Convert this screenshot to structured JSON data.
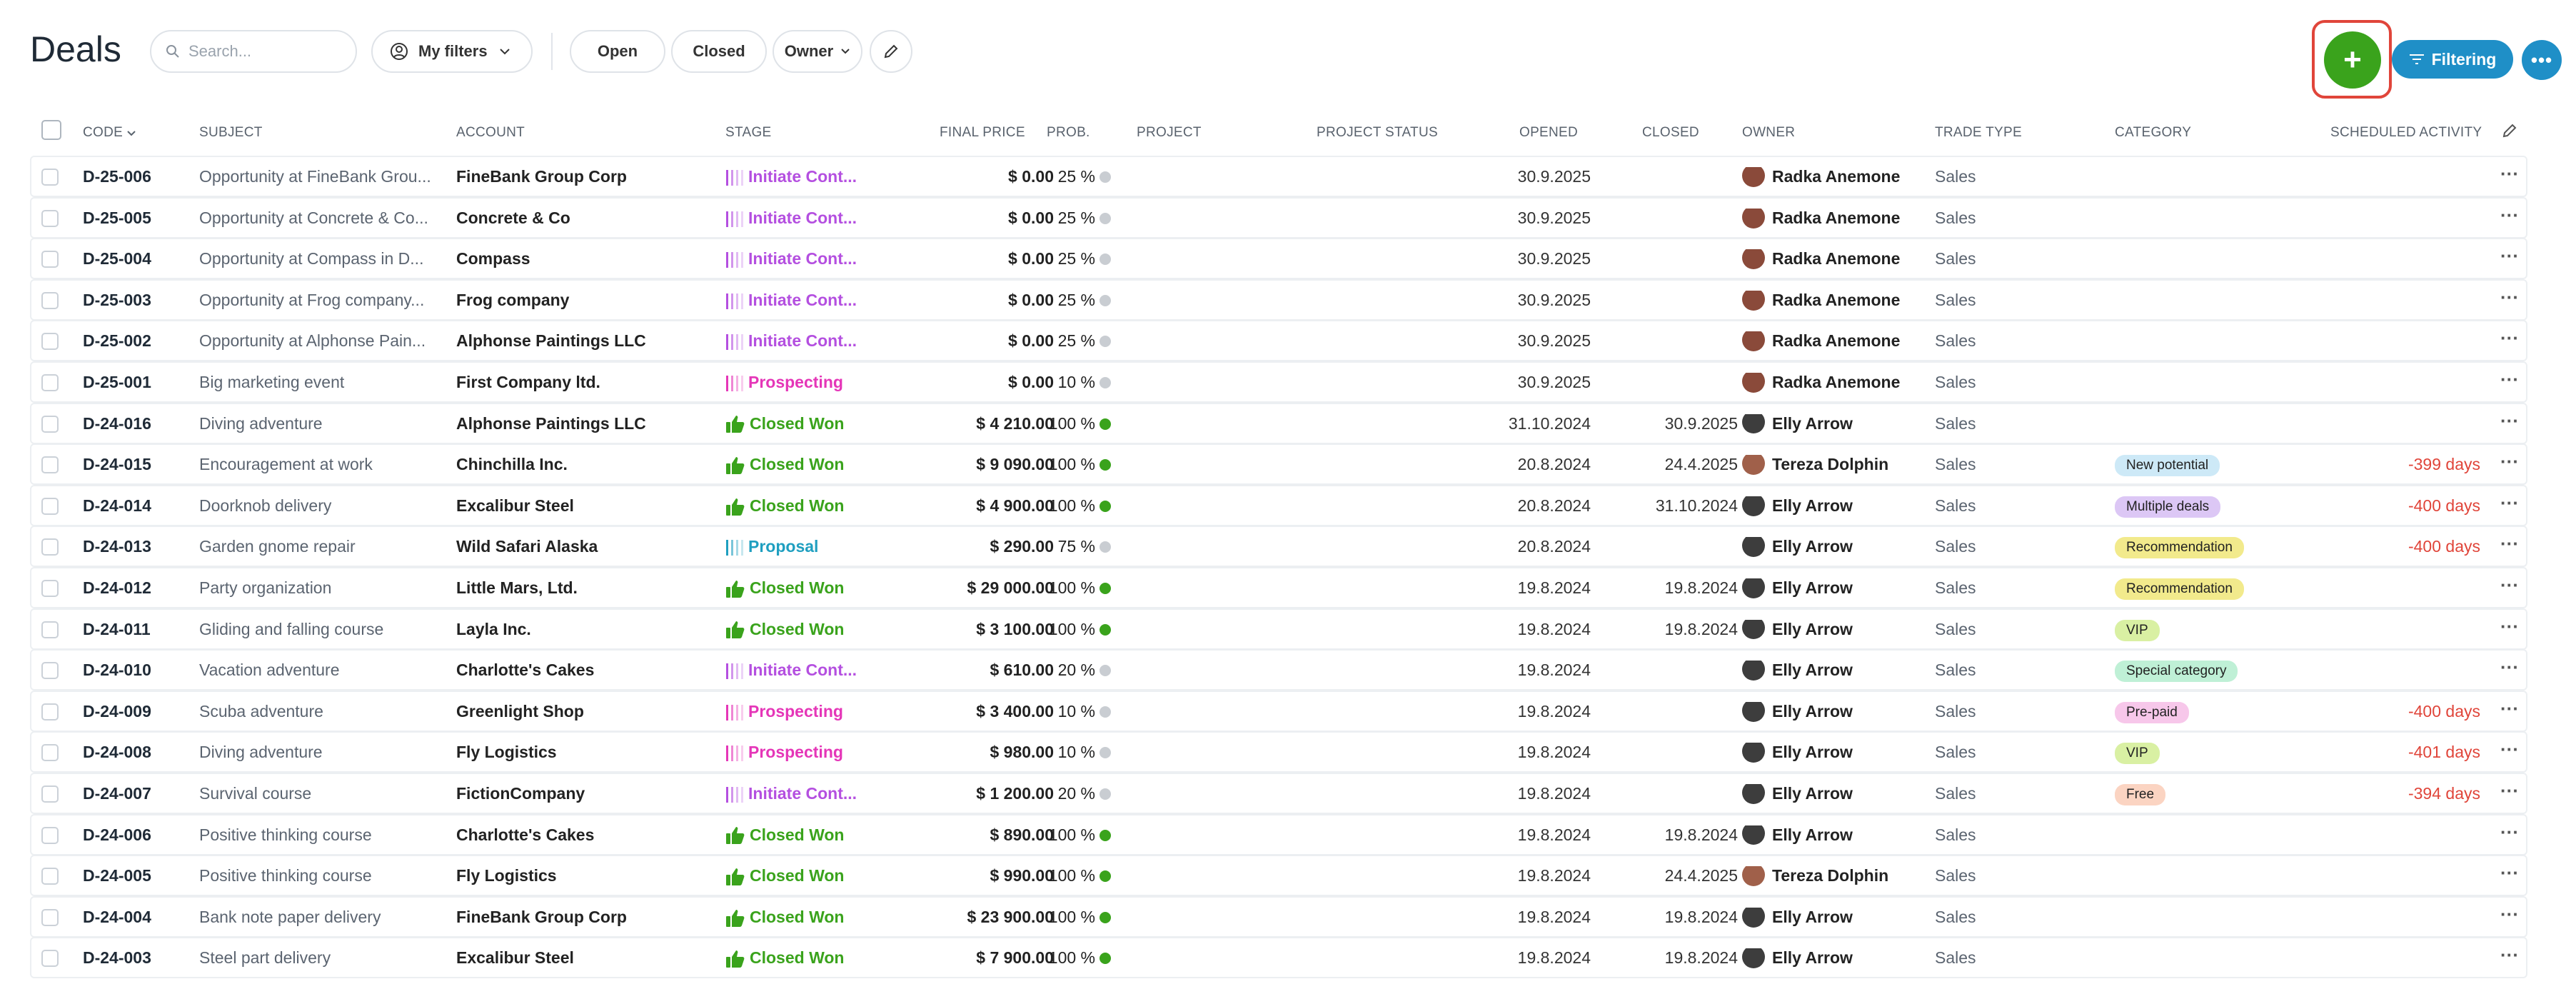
{
  "page_title": "Deals",
  "search": {
    "placeholder": "Search..."
  },
  "toolbar": {
    "my_filters": "My filters",
    "open": "Open",
    "closed": "Closed",
    "owner": "Owner",
    "add_label": "+",
    "filtering": "Filtering",
    "more": "•••"
  },
  "columns": {
    "code": "CODE",
    "subject": "SUBJECT",
    "account": "ACCOUNT",
    "stage": "STAGE",
    "final_price": "FINAL PRICE",
    "prob": "PROB.",
    "project": "PROJECT",
    "project_status": "PROJECT STATUS",
    "opened": "OPENED",
    "closed": "CLOSED",
    "owner": "OWNER",
    "trade_type": "TRADE TYPE",
    "category": "CATEGORY",
    "scheduled_activity": "SCHEDULED ACTIVITY"
  },
  "colors": {
    "initiate": "#b44fe0",
    "prospecting": "#e536b8",
    "won": "#3aa31c",
    "proposal": "#1f9fc0",
    "dot_grey": "#c9cdd2",
    "dot_green": "#3aa31c"
  },
  "rows": [
    {
      "code": "D-25-006",
      "subject": "Opportunity at FineBank Grou...",
      "account": "FineBank Group Corp",
      "stage": "Initiate Cont...",
      "stage_kind": "initiate",
      "price": "$ 0.00",
      "prob": "25 %",
      "opened": "30.9.2025",
      "closed": "",
      "owner": "Radka Anemone",
      "avatar": "#8a4a3a",
      "trade": "Sales",
      "category": "",
      "cat_color": "",
      "sched": ""
    },
    {
      "code": "D-25-005",
      "subject": "Opportunity at Concrete & Co...",
      "account": "Concrete & Co",
      "stage": "Initiate Cont...",
      "stage_kind": "initiate",
      "price": "$ 0.00",
      "prob": "25 %",
      "opened": "30.9.2025",
      "closed": "",
      "owner": "Radka Anemone",
      "avatar": "#8a4a3a",
      "trade": "Sales",
      "category": "",
      "cat_color": "",
      "sched": ""
    },
    {
      "code": "D-25-004",
      "subject": "Opportunity at Compass in D...",
      "account": "Compass",
      "stage": "Initiate Cont...",
      "stage_kind": "initiate",
      "price": "$ 0.00",
      "prob": "25 %",
      "opened": "30.9.2025",
      "closed": "",
      "owner": "Radka Anemone",
      "avatar": "#8a4a3a",
      "trade": "Sales",
      "category": "",
      "cat_color": "",
      "sched": ""
    },
    {
      "code": "D-25-003",
      "subject": "Opportunity at Frog company...",
      "account": "Frog company",
      "stage": "Initiate Cont...",
      "stage_kind": "initiate",
      "price": "$ 0.00",
      "prob": "25 %",
      "opened": "30.9.2025",
      "closed": "",
      "owner": "Radka Anemone",
      "avatar": "#8a4a3a",
      "trade": "Sales",
      "category": "",
      "cat_color": "",
      "sched": ""
    },
    {
      "code": "D-25-002",
      "subject": "Opportunity at Alphonse Pain...",
      "account": "Alphonse Paintings LLC",
      "stage": "Initiate Cont...",
      "stage_kind": "initiate",
      "price": "$ 0.00",
      "prob": "25 %",
      "opened": "30.9.2025",
      "closed": "",
      "owner": "Radka Anemone",
      "avatar": "#8a4a3a",
      "trade": "Sales",
      "category": "",
      "cat_color": "",
      "sched": ""
    },
    {
      "code": "D-25-001",
      "subject": "Big marketing event",
      "account": "First Company ltd.",
      "stage": "Prospecting",
      "stage_kind": "prospecting",
      "price": "$ 0.00",
      "prob": "10 %",
      "opened": "30.9.2025",
      "closed": "",
      "owner": "Radka Anemone",
      "avatar": "#8a4a3a",
      "trade": "Sales",
      "category": "",
      "cat_color": "",
      "sched": ""
    },
    {
      "code": "D-24-016",
      "subject": "Diving adventure",
      "account": "Alphonse Paintings LLC",
      "stage": "Closed Won",
      "stage_kind": "won",
      "price": "$ 4 210.00",
      "prob": "100 %",
      "opened": "31.10.2024",
      "closed": "30.9.2025",
      "owner": "Elly Arrow",
      "avatar": "#3d3d3d",
      "trade": "Sales",
      "category": "",
      "cat_color": "",
      "sched": ""
    },
    {
      "code": "D-24-015",
      "subject": "Encouragement at work",
      "account": "Chinchilla Inc.",
      "stage": "Closed Won",
      "stage_kind": "won",
      "price": "$ 9 090.00",
      "prob": "100 %",
      "opened": "20.8.2024",
      "closed": "24.4.2025",
      "owner": "Tereza Dolphin",
      "avatar": "#a0604a",
      "trade": "Sales",
      "category": "New potential",
      "cat_color": "#cde9f7",
      "sched": "-399 days"
    },
    {
      "code": "D-24-014",
      "subject": "Doorknob delivery",
      "account": "Excalibur Steel",
      "stage": "Closed Won",
      "stage_kind": "won",
      "price": "$ 4 900.00",
      "prob": "100 %",
      "opened": "20.8.2024",
      "closed": "31.10.2024",
      "owner": "Elly Arrow",
      "avatar": "#3d3d3d",
      "trade": "Sales",
      "category": "Multiple deals",
      "cat_color": "#dcc7f5",
      "sched": "-400 days"
    },
    {
      "code": "D-24-013",
      "subject": "Garden gnome repair",
      "account": "Wild Safari Alaska",
      "stage": "Proposal",
      "stage_kind": "proposal",
      "price": "$ 290.00",
      "prob": "75 %",
      "opened": "20.8.2024",
      "closed": "",
      "owner": "Elly Arrow",
      "avatar": "#3d3d3d",
      "trade": "Sales",
      "category": "Recommendation",
      "cat_color": "#f2ea8c",
      "sched": "-400 days"
    },
    {
      "code": "D-24-012",
      "subject": "Party organization",
      "account": "Little Mars, Ltd.",
      "stage": "Closed Won",
      "stage_kind": "won",
      "price": "$ 29 000.00",
      "prob": "100 %",
      "opened": "19.8.2024",
      "closed": "19.8.2024",
      "owner": "Elly Arrow",
      "avatar": "#3d3d3d",
      "trade": "Sales",
      "category": "Recommendation",
      "cat_color": "#f2ea8c",
      "sched": ""
    },
    {
      "code": "D-24-011",
      "subject": "Gliding and falling course",
      "account": "Layla Inc.",
      "stage": "Closed Won",
      "stage_kind": "won",
      "price": "$ 3 100.00",
      "prob": "100 %",
      "opened": "19.8.2024",
      "closed": "19.8.2024",
      "owner": "Elly Arrow",
      "avatar": "#3d3d3d",
      "trade": "Sales",
      "category": "VIP",
      "cat_color": "#d9f0a3",
      "sched": ""
    },
    {
      "code": "D-24-010",
      "subject": "Vacation adventure",
      "account": "Charlotte's Cakes",
      "stage": "Initiate Cont...",
      "stage_kind": "initiate",
      "price": "$ 610.00",
      "prob": "20 %",
      "opened": "19.8.2024",
      "closed": "",
      "owner": "Elly Arrow",
      "avatar": "#3d3d3d",
      "trade": "Sales",
      "category": "Special category",
      "cat_color": "#bff0d6",
      "sched": ""
    },
    {
      "code": "D-24-009",
      "subject": "Scuba adventure",
      "account": "Greenlight Shop",
      "stage": "Prospecting",
      "stage_kind": "prospecting",
      "price": "$ 3 400.00",
      "prob": "10 %",
      "opened": "19.8.2024",
      "closed": "",
      "owner": "Elly Arrow",
      "avatar": "#3d3d3d",
      "trade": "Sales",
      "category": "Pre-paid",
      "cat_color": "#f7c7ea",
      "sched": "-400 days"
    },
    {
      "code": "D-24-008",
      "subject": "Diving adventure",
      "account": "Fly Logistics",
      "stage": "Prospecting",
      "stage_kind": "prospecting",
      "price": "$ 980.00",
      "prob": "10 %",
      "opened": "19.8.2024",
      "closed": "",
      "owner": "Elly Arrow",
      "avatar": "#3d3d3d",
      "trade": "Sales",
      "category": "VIP",
      "cat_color": "#d9f0a3",
      "sched": "-401 days"
    },
    {
      "code": "D-24-007",
      "subject": "Survival course",
      "account": "FictionCompany",
      "stage": "Initiate Cont...",
      "stage_kind": "initiate",
      "price": "$ 1 200.00",
      "prob": "20 %",
      "opened": "19.8.2024",
      "closed": "",
      "owner": "Elly Arrow",
      "avatar": "#3d3d3d",
      "trade": "Sales",
      "category": "Free",
      "cat_color": "#fbd4c2",
      "sched": "-394 days"
    },
    {
      "code": "D-24-006",
      "subject": "Positive thinking course",
      "account": "Charlotte's Cakes",
      "stage": "Closed Won",
      "stage_kind": "won",
      "price": "$ 890.00",
      "prob": "100 %",
      "opened": "19.8.2024",
      "closed": "19.8.2024",
      "owner": "Elly Arrow",
      "avatar": "#3d3d3d",
      "trade": "Sales",
      "category": "",
      "cat_color": "",
      "sched": ""
    },
    {
      "code": "D-24-005",
      "subject": "Positive thinking course",
      "account": "Fly Logistics",
      "stage": "Closed Won",
      "stage_kind": "won",
      "price": "$ 990.00",
      "prob": "100 %",
      "opened": "19.8.2024",
      "closed": "24.4.2025",
      "owner": "Tereza Dolphin",
      "avatar": "#a0604a",
      "trade": "Sales",
      "category": "",
      "cat_color": "",
      "sched": ""
    },
    {
      "code": "D-24-004",
      "subject": "Bank note paper delivery",
      "account": "FineBank Group Corp",
      "stage": "Closed Won",
      "stage_kind": "won",
      "price": "$ 23 900.00",
      "prob": "100 %",
      "opened": "19.8.2024",
      "closed": "19.8.2024",
      "owner": "Elly Arrow",
      "avatar": "#3d3d3d",
      "trade": "Sales",
      "category": "",
      "cat_color": "",
      "sched": ""
    },
    {
      "code": "D-24-003",
      "subject": "Steel part delivery",
      "account": "Excalibur Steel",
      "stage": "Closed Won",
      "stage_kind": "won",
      "price": "$ 7 900.00",
      "prob": "100 %",
      "opened": "19.8.2024",
      "closed": "19.8.2024",
      "owner": "Elly Arrow",
      "avatar": "#3d3d3d",
      "trade": "Sales",
      "category": "",
      "cat_color": "",
      "sched": ""
    }
  ]
}
